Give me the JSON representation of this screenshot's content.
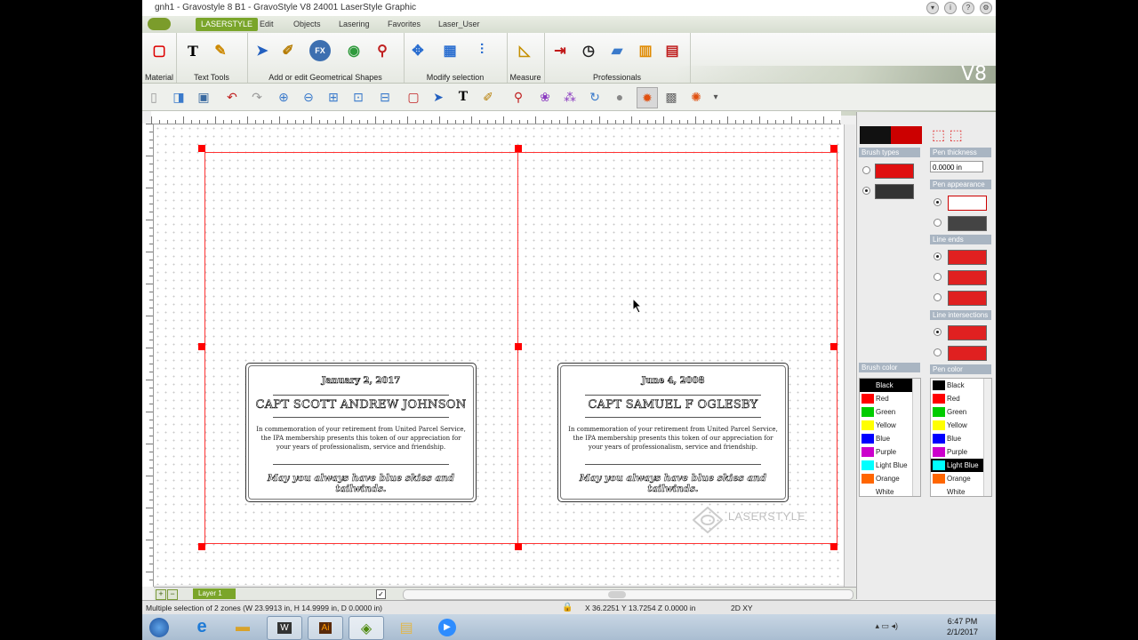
{
  "window": {
    "title": "gnh1 - Gravostyle 8 B1 - GravoStyle V8 24001 LaserStyle Graphic"
  },
  "menu": [
    "LASERSTYLE",
    "Edit",
    "Objects",
    "Lasering",
    "Favorites",
    "Laser_User"
  ],
  "ribbon": {
    "groups": [
      "Material",
      "Text Tools",
      "Add or edit Geometrical Shapes",
      "Modify selection",
      "Measure",
      "Professionals"
    ],
    "brand": "V8"
  },
  "canvas": {
    "plates": [
      {
        "date": "January 2, 2017",
        "name": "CAPT SCOTT ANDREW JOHNSON",
        "body": "In commemoration of your retirement from United Parcel Service, the IPA membership presents this token of our appreciation for your years of professionalism, service and friendship.",
        "quote": "May you always have blue skies and tailwinds."
      },
      {
        "date": "June 4, 2008",
        "name": "CAPT SAMUEL F OGLESBY",
        "body": "In commemoration of your retirement from United Parcel Service, the IPA membership presents this token of our appreciation for your years of professionalism, service and friendship.",
        "quote": "May you always have blue skies and tailwinds."
      }
    ],
    "watermark": "LASERSTYLE"
  },
  "layer": {
    "name": "Layer 1"
  },
  "panel": {
    "brush_types": "Brush types",
    "pen_thickness": "Pen thickness",
    "thickness_value": "0.0000 in",
    "pen_appearance": "Pen appearance",
    "line_ends": "Line ends",
    "line_intersections": "Line intersections",
    "brush_color": "Brush color",
    "pen_color": "Pen color",
    "colors": [
      {
        "name": "Black",
        "hex": "#000000"
      },
      {
        "name": "Red",
        "hex": "#ff0000"
      },
      {
        "name": "Green",
        "hex": "#00cc00"
      },
      {
        "name": "Yellow",
        "hex": "#ffff00"
      },
      {
        "name": "Blue",
        "hex": "#0000ff"
      },
      {
        "name": "Purple",
        "hex": "#cc00cc"
      },
      {
        "name": "Light Blue",
        "hex": "#00ffff"
      },
      {
        "name": "Orange",
        "hex": "#ff6600"
      },
      {
        "name": "White",
        "hex": "#ffffff"
      }
    ],
    "brush_selected": "Black",
    "pen_selected": "Light Blue"
  },
  "status": {
    "message": "Multiple selection of 2 zones (W 23.9913 in, H 14.9999 in, D 0.0000 in)",
    "coords": "X 36.2251  Y 13.7254  Z 0.0000 in",
    "mode": "2D XY"
  },
  "clock": {
    "time": "6:47 PM",
    "date": "2/1/2017"
  }
}
